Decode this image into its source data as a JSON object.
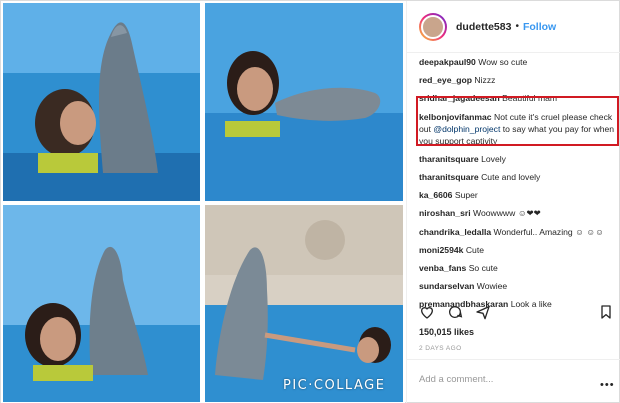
{
  "collage": {
    "watermark": "PIC·COLLAGE"
  },
  "header": {
    "username": "dudette583",
    "separator": "•",
    "follow_label": "Follow"
  },
  "comments": [
    {
      "user": "deepakpaul90",
      "text": "Wow so cute"
    },
    {
      "user": "red_eye_gop",
      "text": "Nizzz"
    },
    {
      "user": "sridhar_jagadeesan",
      "text": "Beautiful mam"
    },
    {
      "user": "kelbonjovifanmac",
      "text_before": "Not cute it's cruel please check out",
      "mention": "@dolphin_project",
      "text_after": "to say what you pay for when you support captivity",
      "highlighted": true
    },
    {
      "user": "tharanitsquare",
      "text": "Lovely"
    },
    {
      "user": "tharanitsquare",
      "text": "Cute and lovely"
    },
    {
      "user": "ka_6606",
      "text": "Super"
    },
    {
      "user": "niroshan_sri",
      "text": "Woowwww ☺❤❤"
    },
    {
      "user": "chandrika_ledalla",
      "text": "Wonderful.. Amazing ☺ ☺☺"
    },
    {
      "user": "moni2594k",
      "text": "Cute"
    },
    {
      "user": "venba_fans",
      "text": "So cute"
    },
    {
      "user": "sundarselvan",
      "text": "Wowiee"
    },
    {
      "user": "premanandbhaskaran",
      "text": "Look a like"
    }
  ],
  "actions": {
    "icons": [
      "heart-icon",
      "comment-icon",
      "share-icon",
      "bookmark-icon"
    ]
  },
  "likes": "150,015 likes",
  "timestamp": "2 DAYS AGO",
  "add_comment": {
    "placeholder": "Add a comment...",
    "more_label": "•••"
  },
  "colors": {
    "follow_blue": "#3897f0",
    "highlight_red": "#d11a23",
    "water_blue": "#2f8fd0"
  }
}
